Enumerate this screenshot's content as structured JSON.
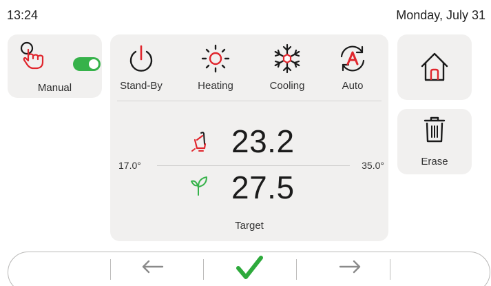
{
  "status": {
    "time": "13:24",
    "date": "Monday, July 31"
  },
  "manual": {
    "label": "Manual",
    "toggle_on": true,
    "icon": "hand-pointer-icon"
  },
  "modes": [
    {
      "label": "Stand-By",
      "icon": "power-icon"
    },
    {
      "label": "Heating",
      "icon": "sun-icon"
    },
    {
      "label": "Cooling",
      "icon": "snowflake-icon"
    },
    {
      "label": "Auto",
      "icon": "auto-cycle-icon"
    }
  ],
  "temperature": {
    "range_min": "17.0°",
    "range_max": "35.0°",
    "current": "23.2",
    "target": "27.5",
    "target_label": "Target"
  },
  "side": {
    "home_icon": "home-icon",
    "erase_label": "Erase",
    "erase_icon": "trash-icon"
  },
  "nav": {
    "back_icon": "arrow-left-icon",
    "confirm_icon": "checkmark-icon",
    "forward_icon": "arrow-right-icon"
  },
  "colors": {
    "accent_red": "#e0262d",
    "toggle_green": "#36b24a",
    "check_green": "#2eaa3c",
    "card_bg": "#f1f0ef"
  }
}
